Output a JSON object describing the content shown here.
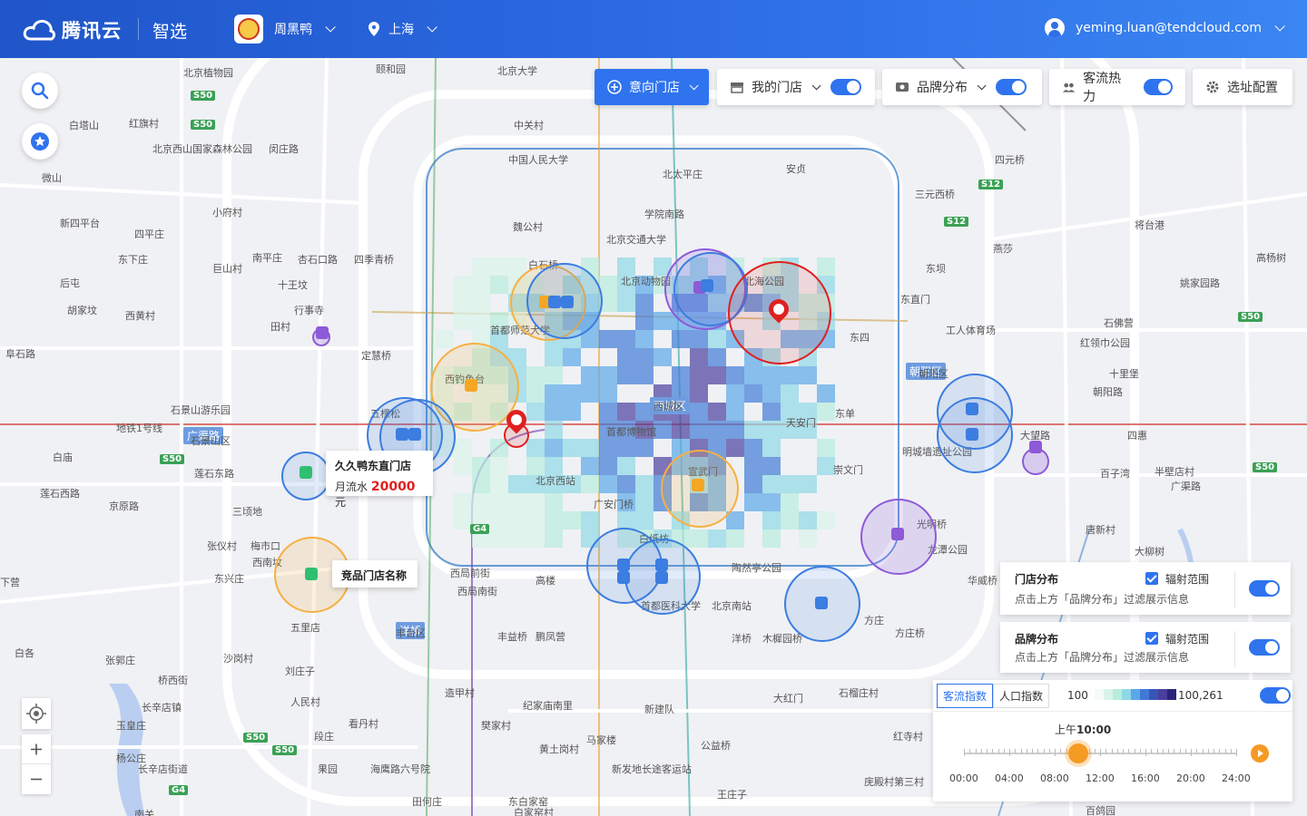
{
  "header": {
    "brand": "腾讯云",
    "product": "智选",
    "shop_name": "周黑鸭",
    "city": "上海",
    "user_email": "yeming.luan@tendcloud.com"
  },
  "toolbar": {
    "intent_store": "意向门店",
    "my_store": "我的门店",
    "brand_dist": "品牌分布",
    "traffic_heat": "客流热力",
    "site_config": "选址配置"
  },
  "popups": {
    "store_name": "久久鸭东直门店",
    "flow_label": "月流水",
    "flow_value": "20000",
    "flow_unit": "元",
    "competitor": "竞品门店名称"
  },
  "panels": {
    "store_dist_title": "门店分布",
    "store_dist_hint": "点击上方「品牌分布」过滤展示信息",
    "radius_label": "辐射范围",
    "brand_dist_title": "品牌分布",
    "brand_dist_hint": "点击上方「品牌分布」过滤展示信息",
    "tab_flow": "客流指数",
    "tab_pop": "人口指数",
    "legend_min": "100",
    "legend_max": "100,261",
    "time_current_prefix": "上午",
    "time_current": "10:00",
    "time_ticks": [
      "00:00",
      "04:00",
      "08:00",
      "12:00",
      "16:00",
      "20:00",
      "24:00"
    ],
    "time_value_fraction": 0.42
  },
  "colors": {
    "brand_blue": "#2f73ee",
    "heat_low": "#b8ecdd",
    "heat_mid": "#5aa8e8",
    "heat_high": "#4a3f9e",
    "competitor_red": "#e02020",
    "slider_orange": "#f59a23"
  },
  "places": [
    "北京植物园",
    "颐和园",
    "北京大学",
    "白塔山",
    "红旗村",
    "北京西山国家森林公园",
    "闵庄路",
    "中关村",
    "中国人民大学",
    "北太平庄",
    "安贞",
    "四元桥",
    "三元西桥",
    "微山",
    "小府村",
    "魏公村",
    "学院南路",
    "北京交通大学",
    "将台港",
    "新四平台",
    "四平庄",
    "燕莎",
    "东坝",
    "南平庄",
    "杏石口路",
    "四季青桥",
    "巨山村",
    "东下庄",
    "十王坟",
    "白石桥",
    "北京动物园",
    "北海公园",
    "东直门",
    "姚家园路",
    "高杨树",
    "后屯",
    "胡家坟",
    "西黄村",
    "行事寺",
    "田村",
    "首都师范大学",
    "工人体育场",
    "石佛营",
    "阜石路",
    "定慧桥",
    "东四",
    "红领巾公园",
    "朝阳区",
    "十里堡",
    "朝阳路",
    "西钓鱼台",
    "石景山游乐园",
    "五棵松",
    "西城区",
    "东单",
    "天安门",
    "大望路",
    "四惠",
    "地铁1号线",
    "石景山区",
    "首都博物馆",
    "明城墙遗址公园",
    "北京西站",
    "白庙",
    "莲石东路",
    "崇文门",
    "宣武门",
    "百子湾",
    "半壁店村",
    "广渠路",
    "莲石西路",
    "京原路",
    "三顷地",
    "广安门桥",
    "光明桥",
    "唐新村",
    "张仪村",
    "梅市口",
    "西南坟",
    "白纸坊",
    "龙潭公园",
    "大柳树",
    "下营",
    "东兴庄",
    "西局前街",
    "高楼",
    "陶然亭公园",
    "西局南街",
    "首都医科大学",
    "北京南站",
    "华威桥",
    "五里店",
    "丰台区",
    "丰益桥",
    "鹏凤营",
    "洋桥",
    "木樨园桥",
    "方庄",
    "方庄桥",
    "白各",
    "张郭庄",
    "沙岗村",
    "刘庄子",
    "桥西街",
    "人民村",
    "造甲村",
    "纪家庙南里",
    "新建队",
    "大红门",
    "石榴庄村",
    "长辛店镇",
    "玉皇庄",
    "看丹村",
    "樊家村",
    "马家楼",
    "公益桥",
    "红寺村",
    "杨公庄",
    "长辛店街道",
    "段庄",
    "黄土岗村",
    "果园",
    "海鹰路六号院",
    "新发地长途客运站",
    "庑殿村第三村",
    "王庄子",
    "东白家窑",
    "白家窑村",
    "田何庄",
    "南关",
    "百鸽园"
  ]
}
